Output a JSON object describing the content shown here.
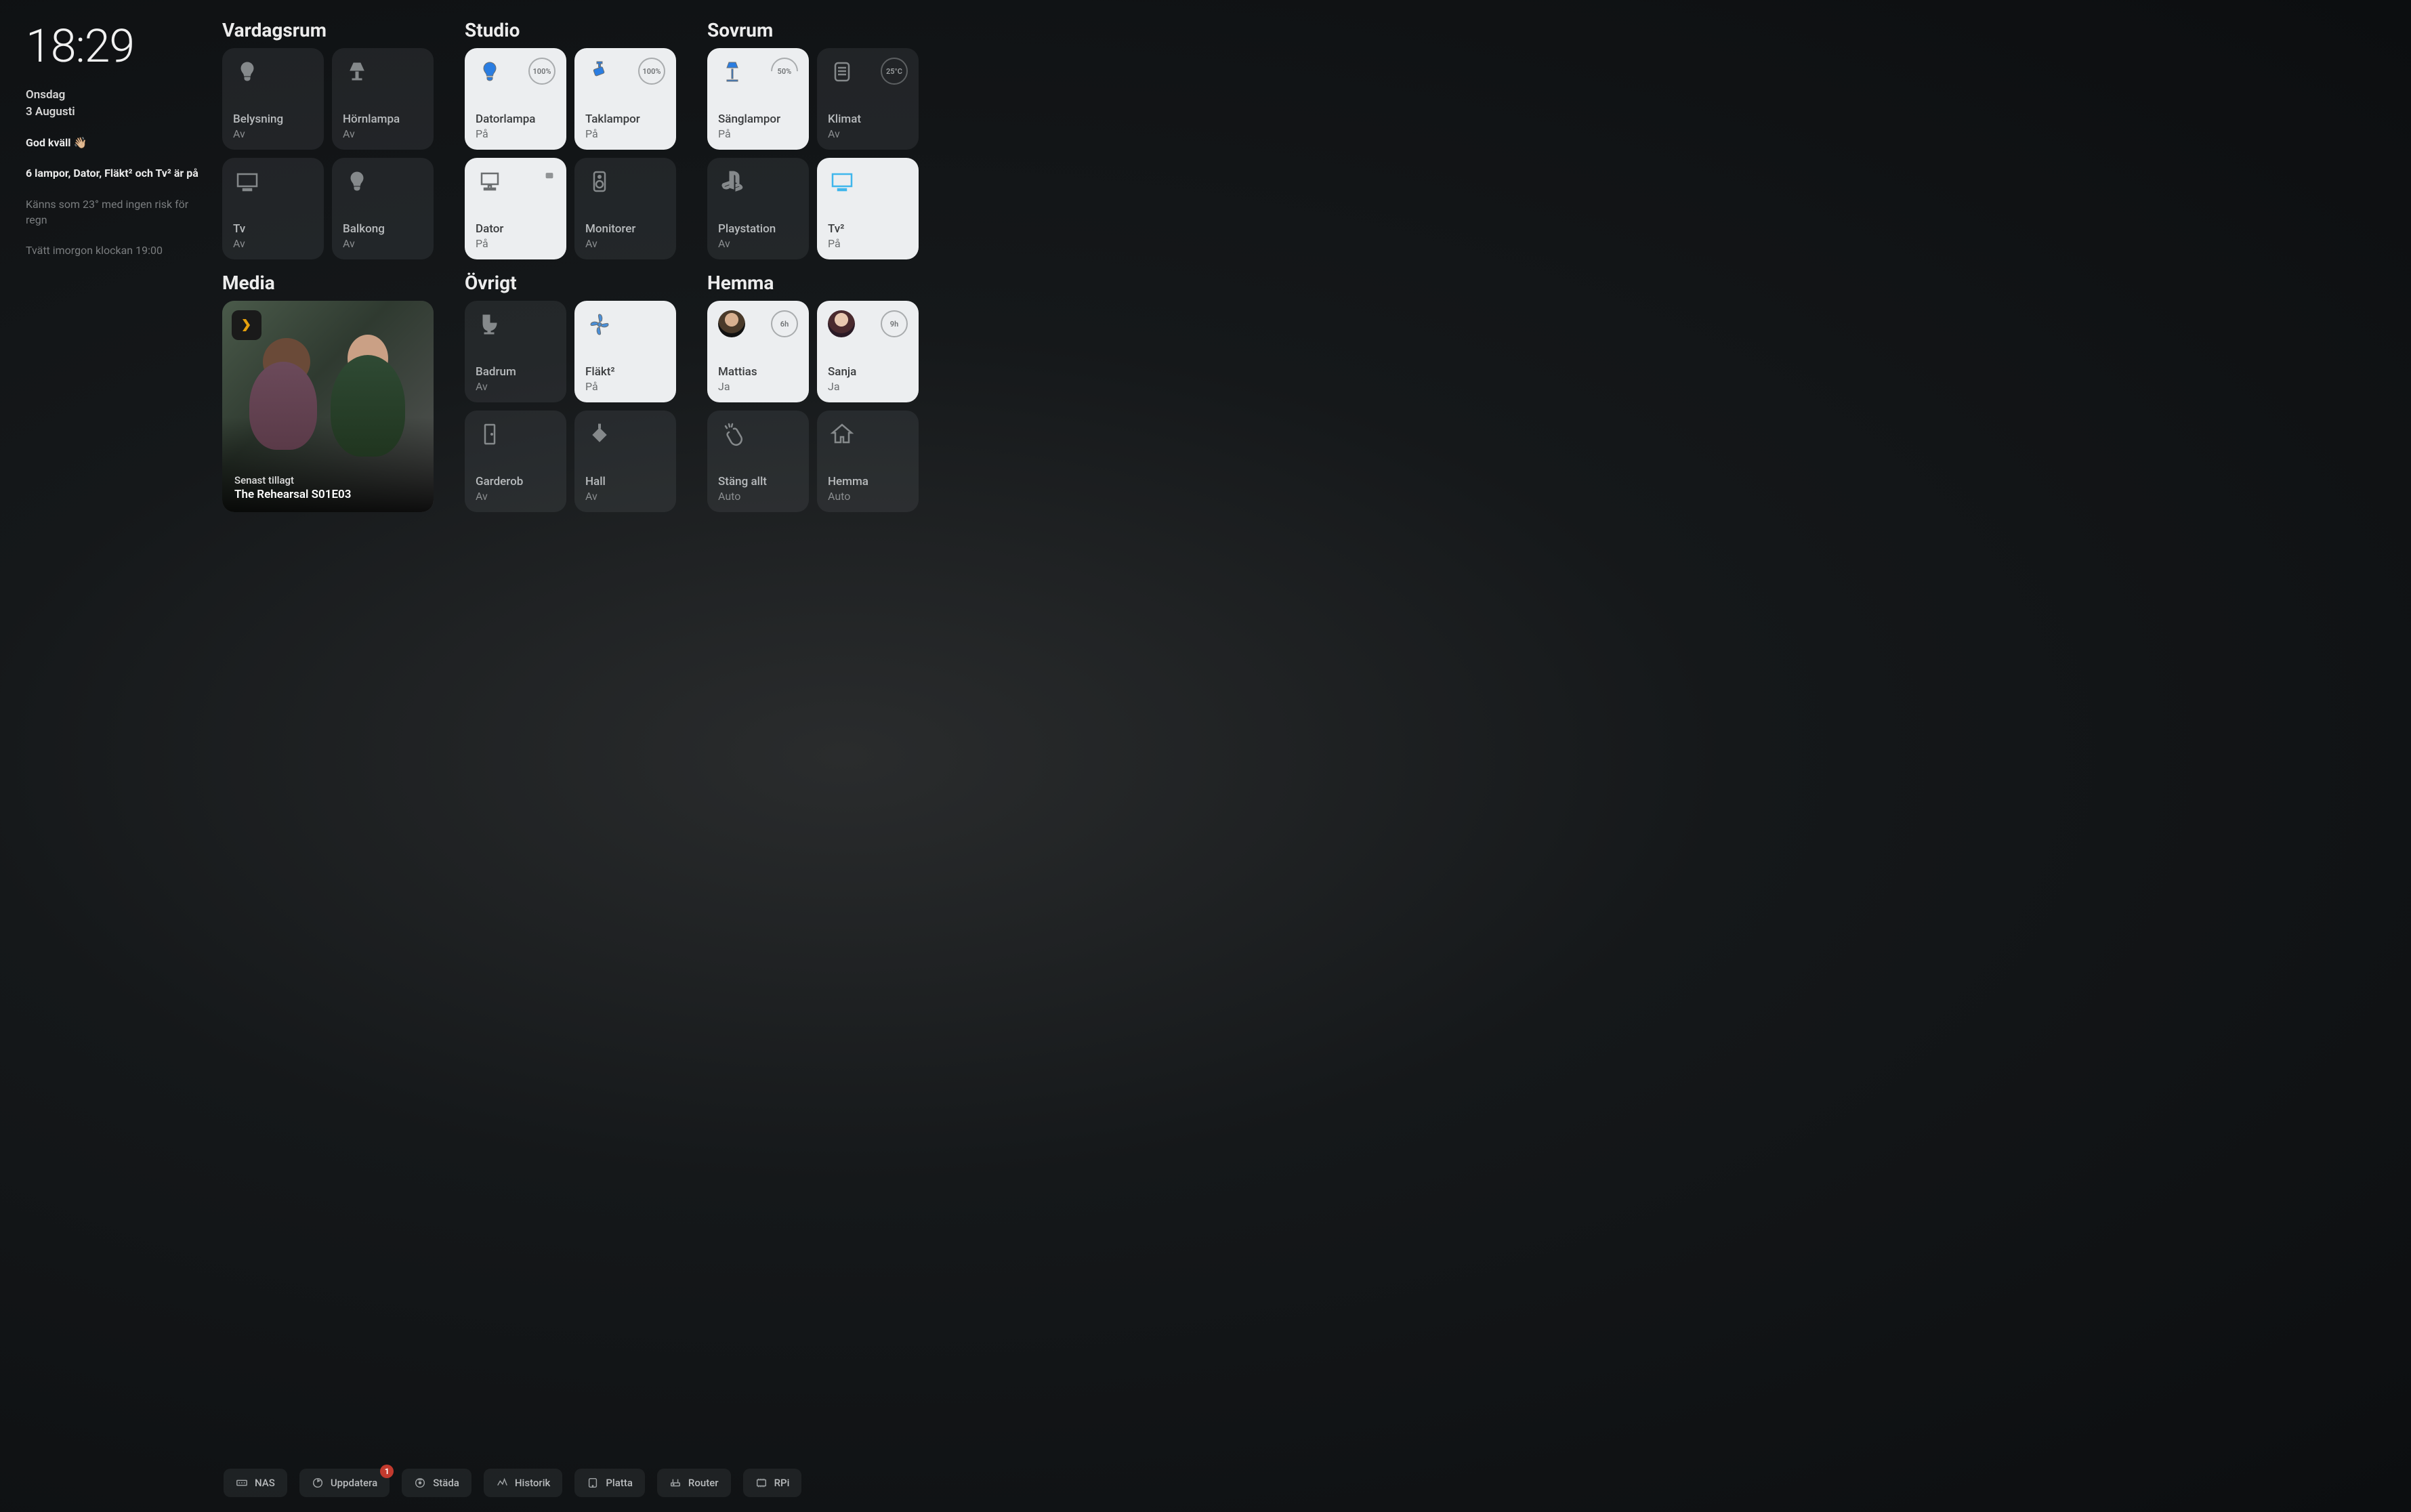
{
  "sidebar": {
    "time": "18:29",
    "weekday": "Onsdag",
    "date": "3 Augusti",
    "greeting": "God kväll",
    "greeting_emoji": "👋🏼",
    "status_line": "6 lampor, Dator, Fläkt² och Tv² är på",
    "weather_line": "Känns som 23° med ingen risk för regn",
    "laundry_line": "Tvätt imorgon klockan 19:00"
  },
  "sections": {
    "vardagsrum": {
      "title": "Vardagsrum",
      "tiles": [
        {
          "name": "Belysning",
          "state": "Av",
          "icon": "bulb",
          "on": false
        },
        {
          "name": "Hörnlampa",
          "state": "Av",
          "icon": "lampshade",
          "on": false
        },
        {
          "name": "Tv",
          "state": "Av",
          "icon": "tv",
          "on": false
        },
        {
          "name": "Balkong",
          "state": "Av",
          "icon": "bulb",
          "on": false
        }
      ]
    },
    "studio": {
      "title": "Studio",
      "tiles": [
        {
          "name": "Datorlampa",
          "state": "På",
          "icon": "bulb",
          "on": true,
          "badge": "100%",
          "icon_color": "blue"
        },
        {
          "name": "Taklampor",
          "state": "På",
          "icon": "spotlight",
          "on": true,
          "badge": "100%",
          "icon_color": "blue"
        },
        {
          "name": "Dator",
          "state": "På",
          "icon": "computer",
          "on": true,
          "locked": true
        },
        {
          "name": "Monitorer",
          "state": "Av",
          "icon": "speaker",
          "on": false
        }
      ]
    },
    "sovrum": {
      "title": "Sovrum",
      "tiles": [
        {
          "name": "Sänglampor",
          "state": "På",
          "icon": "floorlamp",
          "on": true,
          "badge": "50%",
          "badge_half": true,
          "icon_color": "blue"
        },
        {
          "name": "Klimat",
          "state": "Av",
          "icon": "climate",
          "on": false,
          "badge": "25°C",
          "badge_dim": true
        },
        {
          "name": "Playstation",
          "state": "Av",
          "icon": "playstation",
          "on": false
        },
        {
          "name": "Tv²",
          "state": "På",
          "icon": "tv",
          "on": true,
          "icon_color": "blue-screen"
        }
      ]
    },
    "media": {
      "title": "Media",
      "subtitle": "Senast tillagt",
      "item_title": "The Rehearsal S01E03",
      "service_icon": "plex"
    },
    "ovrigt": {
      "title": "Övrigt",
      "tiles": [
        {
          "name": "Badrum",
          "state": "Av",
          "icon": "toilet",
          "on": false
        },
        {
          "name": "Fläkt²",
          "state": "På",
          "icon": "fan",
          "on": true,
          "icon_color": "blue"
        },
        {
          "name": "Garderob",
          "state": "Av",
          "icon": "door",
          "on": false
        },
        {
          "name": "Hall",
          "state": "Av",
          "icon": "pendant",
          "on": false
        }
      ]
    },
    "hemma": {
      "title": "Hemma",
      "tiles": [
        {
          "name": "Mattias",
          "state": "Ja",
          "icon": "avatar1",
          "on": true,
          "badge": "6h"
        },
        {
          "name": "Sanja",
          "state": "Ja",
          "icon": "avatar2",
          "on": true,
          "badge": "9h"
        },
        {
          "name": "Stäng allt",
          "state": "Auto",
          "icon": "clap",
          "on": false
        },
        {
          "name": "Hemma",
          "state": "Auto",
          "icon": "house",
          "on": false
        }
      ]
    }
  },
  "bottom_bar": [
    {
      "label": "NAS",
      "icon": "nas"
    },
    {
      "label": "Uppdatera",
      "icon": "refresh",
      "badge": "1"
    },
    {
      "label": "Städa",
      "icon": "vacuum"
    },
    {
      "label": "Historik",
      "icon": "history"
    },
    {
      "label": "Platta",
      "icon": "tablet"
    },
    {
      "label": "Router",
      "icon": "router"
    },
    {
      "label": "RPi",
      "icon": "rpi"
    }
  ]
}
